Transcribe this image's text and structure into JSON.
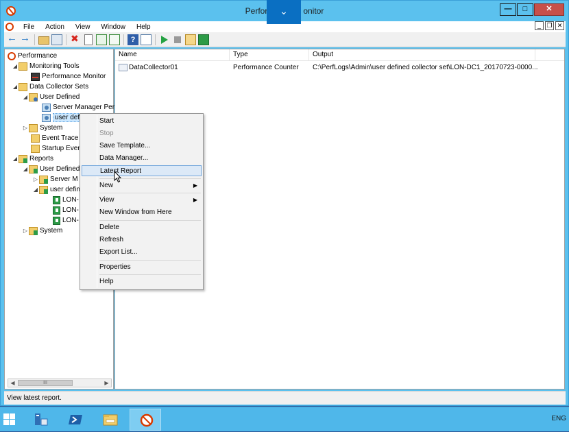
{
  "window": {
    "title": "Performance Monitor",
    "title_visible_left": "Perfor",
    "title_visible_right": "onitor",
    "buttons": {
      "minimize": "—",
      "maximize": "□",
      "close": "✕"
    }
  },
  "overlay": {
    "chevron": "⌄"
  },
  "menubar": {
    "items": [
      "File",
      "Action",
      "View",
      "Window",
      "Help"
    ],
    "child_buttons": [
      "_",
      "❐",
      "✕"
    ]
  },
  "toolbar": {
    "icons": [
      "back-arrow-icon",
      "forward-arrow-icon",
      "up-folder-icon",
      "show-hide-tree-icon",
      "delete-icon",
      "properties-icon",
      "refresh-icon",
      "export-list-icon",
      "help-icon",
      "properties-pane-icon",
      "start-icon",
      "stop-icon",
      "schedule-icon",
      "latest-report-icon"
    ],
    "help_glyph": "?"
  },
  "tree": {
    "items": [
      {
        "label": "Performance",
        "icon": "performance-icon",
        "expander": ""
      },
      {
        "label": "Monitoring Tools",
        "icon": "folder-icon",
        "expander": "◢"
      },
      {
        "label": "Performance Monitor",
        "icon": "monitor-icon",
        "expander": ""
      },
      {
        "label": "Data Collector Sets",
        "icon": "data-collector-sets-icon",
        "expander": "◢"
      },
      {
        "label": "User Defined",
        "icon": "user-defined-icon",
        "expander": "◢"
      },
      {
        "label": "Server Manager Per",
        "icon": "collector-set-icon",
        "expander": ""
      },
      {
        "label": "user defi",
        "icon": "collector-set-icon",
        "expander": ""
      },
      {
        "label": "System",
        "icon": "folder-icon",
        "expander": "▷"
      },
      {
        "label": "Event Trace S",
        "icon": "folder-icon",
        "expander": ""
      },
      {
        "label": "Startup Even",
        "icon": "folder-icon",
        "expander": ""
      },
      {
        "label": "Reports",
        "icon": "reports-icon",
        "expander": "◢"
      },
      {
        "label": "User Defined",
        "icon": "reports-icon",
        "expander": "◢"
      },
      {
        "label": "Server M",
        "icon": "reports-icon",
        "expander": "▷"
      },
      {
        "label": "user defin",
        "icon": "reports-icon",
        "expander": "◢"
      },
      {
        "label": "LON-",
        "icon": "report-icon",
        "expander": ""
      },
      {
        "label": "LON-",
        "icon": "report-icon",
        "expander": ""
      },
      {
        "label": "LON-",
        "icon": "report-icon",
        "expander": ""
      },
      {
        "label": "System",
        "icon": "reports-icon",
        "expander": "▷"
      }
    ],
    "scroll": {
      "left": "◀",
      "right": "▶",
      "thumb": "III"
    }
  },
  "list": {
    "columns": [
      "Name",
      "Type",
      "Output"
    ],
    "rows": [
      {
        "name": "DataCollector01",
        "type": "Performance Counter",
        "output": "C:\\PerfLogs\\Admin\\user defined collector set\\LON-DC1_20170723-0000..."
      }
    ]
  },
  "context_menu": {
    "items": [
      {
        "label": "Start",
        "disabled": false,
        "submenu": false
      },
      {
        "label": "Stop",
        "disabled": true,
        "submenu": false
      },
      {
        "label": "Save Template...",
        "disabled": false,
        "submenu": false
      },
      {
        "label": "Data Manager...",
        "disabled": false,
        "submenu": false
      },
      {
        "label": "Latest Report",
        "disabled": false,
        "submenu": false,
        "highlighted": true
      },
      {
        "label": "New",
        "disabled": false,
        "submenu": true
      },
      {
        "label": "View",
        "disabled": false,
        "submenu": true
      },
      {
        "label": "New Window from Here",
        "disabled": false,
        "submenu": false
      },
      {
        "label": "Delete",
        "disabled": false,
        "submenu": false
      },
      {
        "label": "Refresh",
        "disabled": false,
        "submenu": false
      },
      {
        "label": "Export List...",
        "disabled": false,
        "submenu": false
      },
      {
        "label": "Properties",
        "disabled": false,
        "submenu": false
      },
      {
        "label": "Help",
        "disabled": false,
        "submenu": false
      }
    ],
    "submenu_arrow": "▶"
  },
  "statusbar": {
    "text": "View latest report."
  },
  "taskbar": {
    "apps": [
      "server-manager-icon",
      "powershell-icon",
      "file-explorer-icon",
      "performance-monitor-icon"
    ],
    "language": "ENG"
  },
  "colors": {
    "window_frame": "#5bc1ee",
    "taskbar": "#4fb7ea",
    "close_button": "#c7504a",
    "menu_highlight": "#dce9f7"
  }
}
